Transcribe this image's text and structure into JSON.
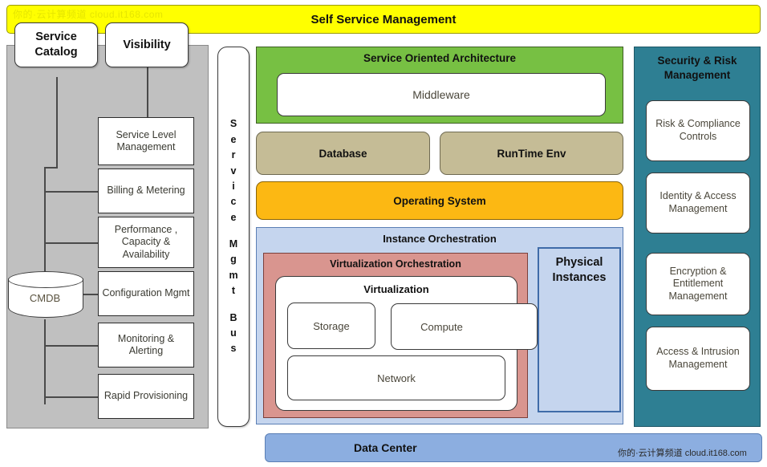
{
  "banners": {
    "top": "Self Service Management",
    "bottom": "Data Center"
  },
  "watermark": {
    "top": "你的·云计算频道 cloud.it168.com",
    "bottom": "你的·云计算频道  cloud.it168.com"
  },
  "top_boxes": [
    {
      "label": "Service Catalog"
    },
    {
      "label": "Visibility"
    }
  ],
  "service_management": {
    "datastore": {
      "label": "CMDB",
      "shape": "cylinder"
    },
    "items": [
      {
        "label": "Service Level Management"
      },
      {
        "label": "Billing & Metering"
      },
      {
        "label": "Performance , Capacity & Availability"
      },
      {
        "label": "Configuration Mgmt"
      },
      {
        "label": "Monitoring & Alerting"
      },
      {
        "label": "Rapid Provisioning"
      }
    ]
  },
  "bus": {
    "words": [
      {
        "letters": [
          "S",
          "e",
          "r",
          "v",
          "i",
          "c",
          "e"
        ]
      },
      {
        "letters": [
          "M",
          "g",
          "m",
          "t"
        ]
      },
      {
        "letters": [
          "B",
          "u",
          "s"
        ]
      }
    ]
  },
  "soa": {
    "title": "Service Oriented Architecture",
    "middleware": "Middleware"
  },
  "platform": {
    "database": "Database",
    "runtime": "RunTime Env",
    "operating_system": "Operating System"
  },
  "instance_orchestration": {
    "title": "Instance Orchestration",
    "virtualization_orchestration": {
      "title": "Virtualization Orchestration",
      "virtualization": {
        "title": "Virtualization",
        "resources": [
          {
            "label": "Storage"
          },
          {
            "label": "Compute"
          },
          {
            "label": "Network"
          }
        ]
      }
    },
    "physical_instances": {
      "title": "Physical Instances"
    }
  },
  "security": {
    "title": "Security & Risk Management",
    "items": [
      {
        "label": "Risk & Compliance Controls"
      },
      {
        "label": "Identity & Access Management"
      },
      {
        "label": "Encryption & Entitlement Management"
      },
      {
        "label": "Access & Intrusion Management"
      }
    ]
  },
  "colors": {
    "banner_top": "#FFFF00",
    "banner_bottom": "#8CAEE0",
    "grey_panel": "#C0C0C0",
    "soa_green": "#77C043",
    "tan": "#C5BC96",
    "os_orange": "#FCB813",
    "instance_blue": "#C5D5EE",
    "virt_pink": "#D9958F",
    "security_teal": "#2E7F93"
  }
}
